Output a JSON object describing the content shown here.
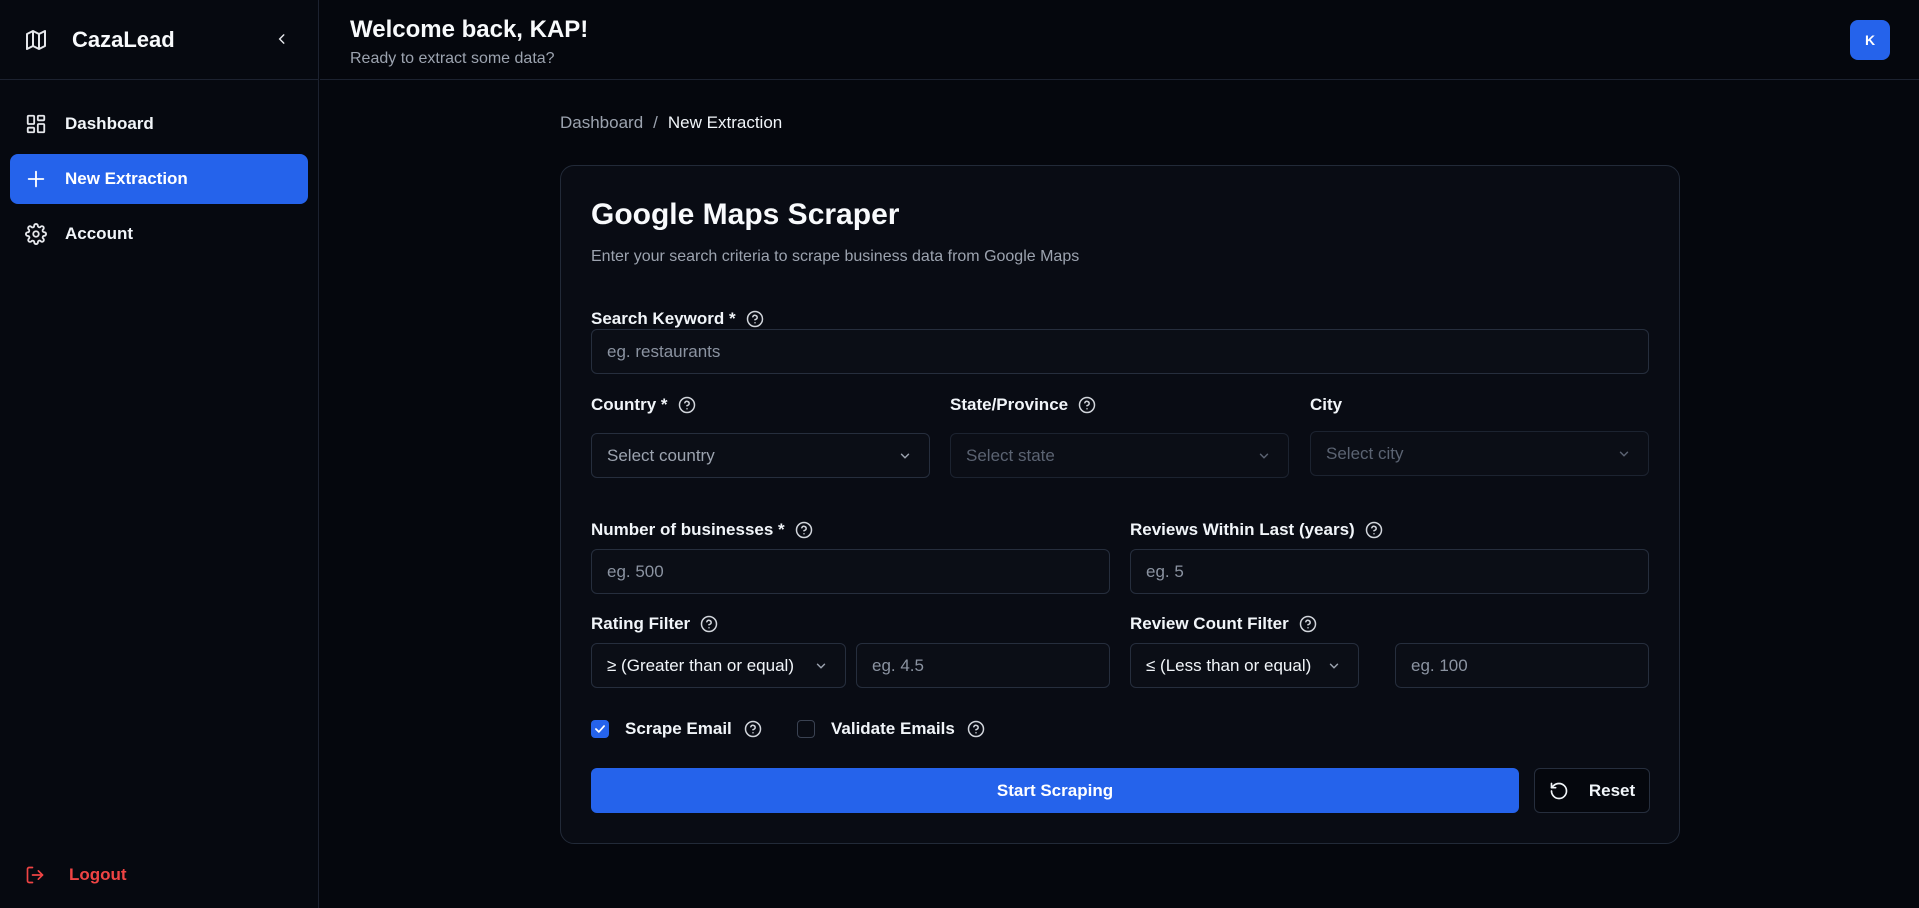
{
  "app": {
    "name": "CazaLead"
  },
  "sidebar": {
    "items": [
      {
        "label": "Dashboard",
        "icon": "dashboard-grid-icon",
        "active": false
      },
      {
        "label": "New Extraction",
        "icon": "plus-icon",
        "active": true
      },
      {
        "label": "Account",
        "icon": "gear-icon",
        "active": false
      }
    ],
    "logout_label": "Logout"
  },
  "header": {
    "welcome": "Welcome back, KAP!",
    "subtitle": "Ready to extract some data?",
    "avatar_initial": "K"
  },
  "breadcrumb": {
    "root": "Dashboard",
    "separator": "/",
    "current": "New Extraction"
  },
  "form": {
    "title": "Google Maps Scraper",
    "description": "Enter your search criteria to scrape business data from Google Maps",
    "keyword": {
      "label": "Search Keyword *",
      "placeholder": "eg. restaurants"
    },
    "country": {
      "label": "Country *",
      "placeholder": "Select country"
    },
    "state": {
      "label": "State/Province",
      "placeholder": "Select state"
    },
    "city": {
      "label": "City",
      "placeholder": "Select city"
    },
    "num_businesses": {
      "label": "Number of businesses *",
      "placeholder": "eg. 500"
    },
    "reviews_within": {
      "label": "Reviews Within Last (years)",
      "placeholder": "eg. 5"
    },
    "rating_filter": {
      "label": "Rating Filter",
      "operator": "≥ (Greater than or equal)",
      "placeholder": "eg. 4.5"
    },
    "review_count_filter": {
      "label": "Review Count Filter",
      "operator": "≤ (Less than or equal)",
      "placeholder": "eg. 100"
    },
    "scrape_email": {
      "label": "Scrape Email",
      "checked": true
    },
    "validate_emails": {
      "label": "Validate Emails",
      "checked": false
    },
    "submit_label": "Start Scraping",
    "reset_label": "Reset"
  },
  "colors": {
    "accent": "#2563eb",
    "danger": "#ef4444",
    "background": "#05070d"
  }
}
